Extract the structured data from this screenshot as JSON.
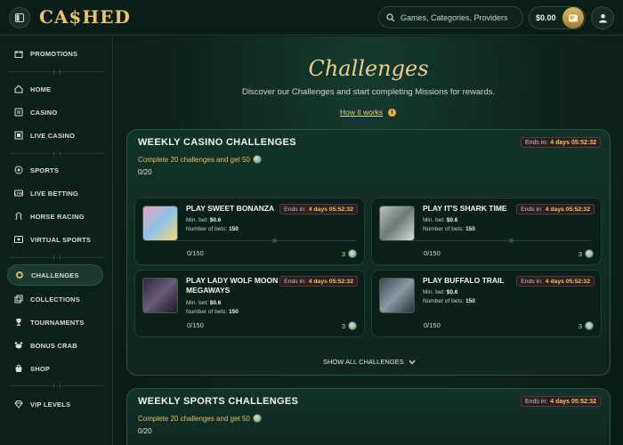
{
  "header": {
    "logo": "CA$HED",
    "search_placeholder": "Games, Categories, Providers",
    "balance": "$0.00"
  },
  "sidebar": {
    "items": [
      {
        "label": "PROMOTIONS",
        "icon": "gift-icon"
      },
      {
        "label": "HOME",
        "icon": "home-icon"
      },
      {
        "label": "CASINO",
        "icon": "casino-icon"
      },
      {
        "label": "LIVE CASINO",
        "icon": "live-casino-icon"
      },
      {
        "label": "SPORTS",
        "icon": "sports-icon"
      },
      {
        "label": "LIVE BETTING",
        "icon": "live-betting-icon"
      },
      {
        "label": "HORSE RACING",
        "icon": "horse-icon"
      },
      {
        "label": "VIRTUAL SPORTS",
        "icon": "virtual-sports-icon"
      },
      {
        "label": "CHALLENGES",
        "icon": "challenges-icon"
      },
      {
        "label": "COLLECTIONS",
        "icon": "collections-icon"
      },
      {
        "label": "TOURNAMENTS",
        "icon": "trophy-icon"
      },
      {
        "label": "BONUS CRAB",
        "icon": "bonus-crab-icon"
      },
      {
        "label": "SHOP",
        "icon": "shop-icon"
      },
      {
        "label": "VIP LEVELS",
        "icon": "diamond-icon"
      }
    ]
  },
  "hero": {
    "title": "Challenges",
    "subtitle": "Discover our Challenges and start completing Missions for rewards.",
    "how_link": "How it works"
  },
  "casino_section": {
    "title": "WEEKLY CASINO CHALLENGES",
    "subtitle": "Complete 20 challenges and get 50",
    "count": "0/20",
    "ends_label": "Ends in:",
    "ends_value": "4 days 05:52:32",
    "show_all": "SHOW ALL CHALLENGES",
    "cards": [
      {
        "title": "PLAY SWEET BONANZA",
        "ends_label": "Ends in:",
        "ends_value": "4 days 05:52:32",
        "min_bet_label": "Min. bet:",
        "min_bet": "$0.6",
        "bets_label": "Number of bets:",
        "bets": "150",
        "progress": "0/150",
        "reward": "3"
      },
      {
        "title": "PLAY IT'S SHARK TIME",
        "ends_label": "Ends in:",
        "ends_value": "4 days 05:52:32",
        "min_bet_label": "Min. bet:",
        "min_bet": "$0.6",
        "bets_label": "Number of bets:",
        "bets": "150",
        "progress": "0/150",
        "reward": "3"
      },
      {
        "title": "PLAY LADY WOLF MOON MEGAWAYS",
        "ends_label": "Ends in:",
        "ends_value": "4 days 05:52:32",
        "min_bet_label": "Min. bet:",
        "min_bet": "$0.6",
        "bets_label": "Number of bets:",
        "bets": "150",
        "progress": "0/150",
        "reward": "3"
      },
      {
        "title": "PLAY BUFFALO TRAIL",
        "ends_label": "Ends in:",
        "ends_value": "4 days 05:52:32",
        "min_bet_label": "Min. bet:",
        "min_bet": "$0.6",
        "bets_label": "Number of bets:",
        "bets": "150",
        "progress": "0/150",
        "reward": "3"
      }
    ]
  },
  "sports_section": {
    "title": "WEEKLY SPORTS CHALLENGES",
    "subtitle": "Complete 20 challenges and get 50",
    "count": "0/20",
    "ends_label": "Ends in:",
    "ends_value": "4 days 05:52:32"
  }
}
